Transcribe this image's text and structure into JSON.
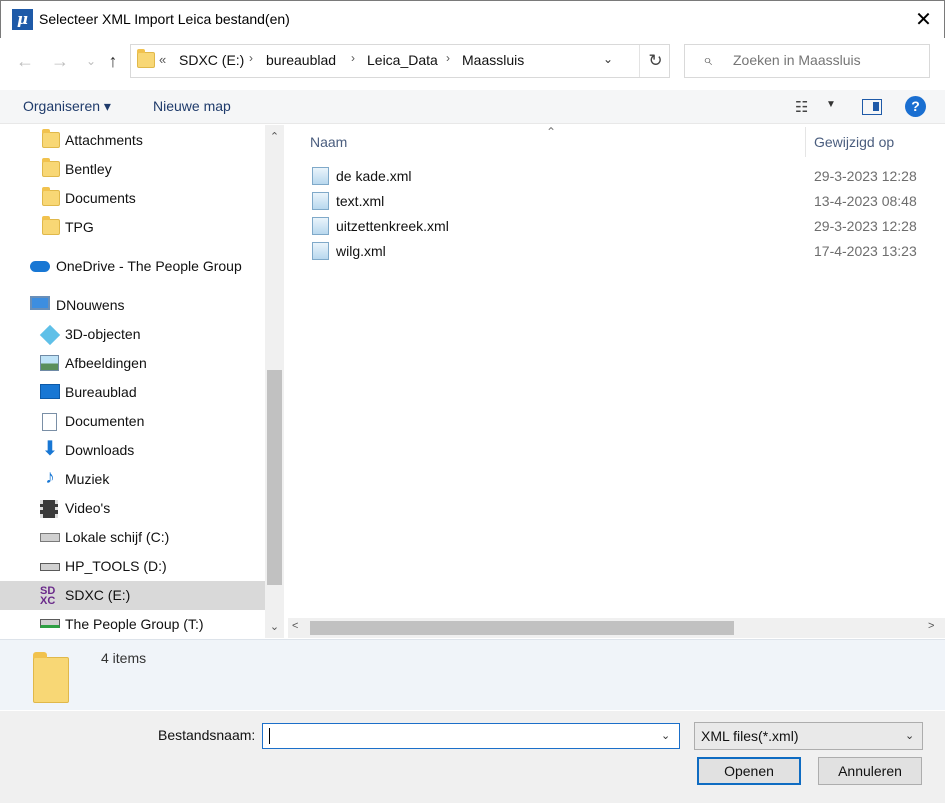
{
  "window": {
    "title": "Selecteer XML Import Leica bestand(en)",
    "app_icon_glyph": "μ",
    "close_glyph": "✕"
  },
  "nav": {
    "back_glyph": "←",
    "forward_glyph": "→",
    "recent_glyph": "⌄",
    "up_glyph": "↑"
  },
  "address": {
    "overflow": "«",
    "crumbs": [
      "SDXC (E:)",
      "bureaublad",
      "Leica_Data",
      "Maassluis"
    ],
    "separator": "›",
    "dropdown_glyph": "⌄",
    "refresh_glyph": "↻"
  },
  "search": {
    "placeholder": "Zoeken in Maassluis"
  },
  "toolbar": {
    "organize": "Organiseren ▾",
    "new_folder": "Nieuwe map",
    "view_glyph": "☷",
    "view_caret": "▼",
    "help": "?"
  },
  "sidebar": {
    "items": [
      {
        "label": "Attachments",
        "icon": "folder-icon"
      },
      {
        "label": "Bentley",
        "icon": "folder-icon"
      },
      {
        "label": "Documents",
        "icon": "folder-icon"
      },
      {
        "label": "TPG",
        "icon": "folder-icon"
      },
      {
        "label": "OneDrive - The People Group",
        "icon": "cloud-icon"
      },
      {
        "label": "DNouwens",
        "icon": "computer-icon"
      },
      {
        "label": "3D-objecten",
        "icon": "cube-icon"
      },
      {
        "label": "Afbeeldingen",
        "icon": "pictures-icon"
      },
      {
        "label": "Bureaublad",
        "icon": "desktop-icon"
      },
      {
        "label": "Documenten",
        "icon": "document-icon"
      },
      {
        "label": "Downloads",
        "icon": "download-icon"
      },
      {
        "label": "Muziek",
        "icon": "music-icon"
      },
      {
        "label": "Video's",
        "icon": "video-icon"
      },
      {
        "label": "Lokale schijf (C:)",
        "icon": "drive-icon"
      },
      {
        "label": "HP_TOOLS (D:)",
        "icon": "drive-icon"
      },
      {
        "label": "SDXC (E:)",
        "icon": "sd-card-icon"
      },
      {
        "label": "The People Group (T:)",
        "icon": "network-drive-icon"
      }
    ],
    "selected": "SDXC (E:)"
  },
  "filelist": {
    "columns": {
      "name": "Naam",
      "modified": "Gewijzigd op"
    },
    "sort_glyph": "⌃",
    "files": [
      {
        "name": "de kade.xml",
        "modified": "29-3-2023 12:28"
      },
      {
        "name": "text.xml",
        "modified": "13-4-2023 08:48"
      },
      {
        "name": "uitzettenkreek.xml",
        "modified": "29-3-2023 12:28"
      },
      {
        "name": "wilg.xml",
        "modified": "17-4-2023 13:23"
      }
    ]
  },
  "scroll": {
    "up": "⌃",
    "down": "⌄",
    "left": "<",
    "right": ">"
  },
  "details": {
    "count": "4 items"
  },
  "bottom": {
    "filename_label": "Bestandsnaam:",
    "filename_value": "",
    "dropdown_glyph": "⌄",
    "filetype": "XML files(*.xml)",
    "open": "Openen",
    "cancel": "Annuleren"
  }
}
